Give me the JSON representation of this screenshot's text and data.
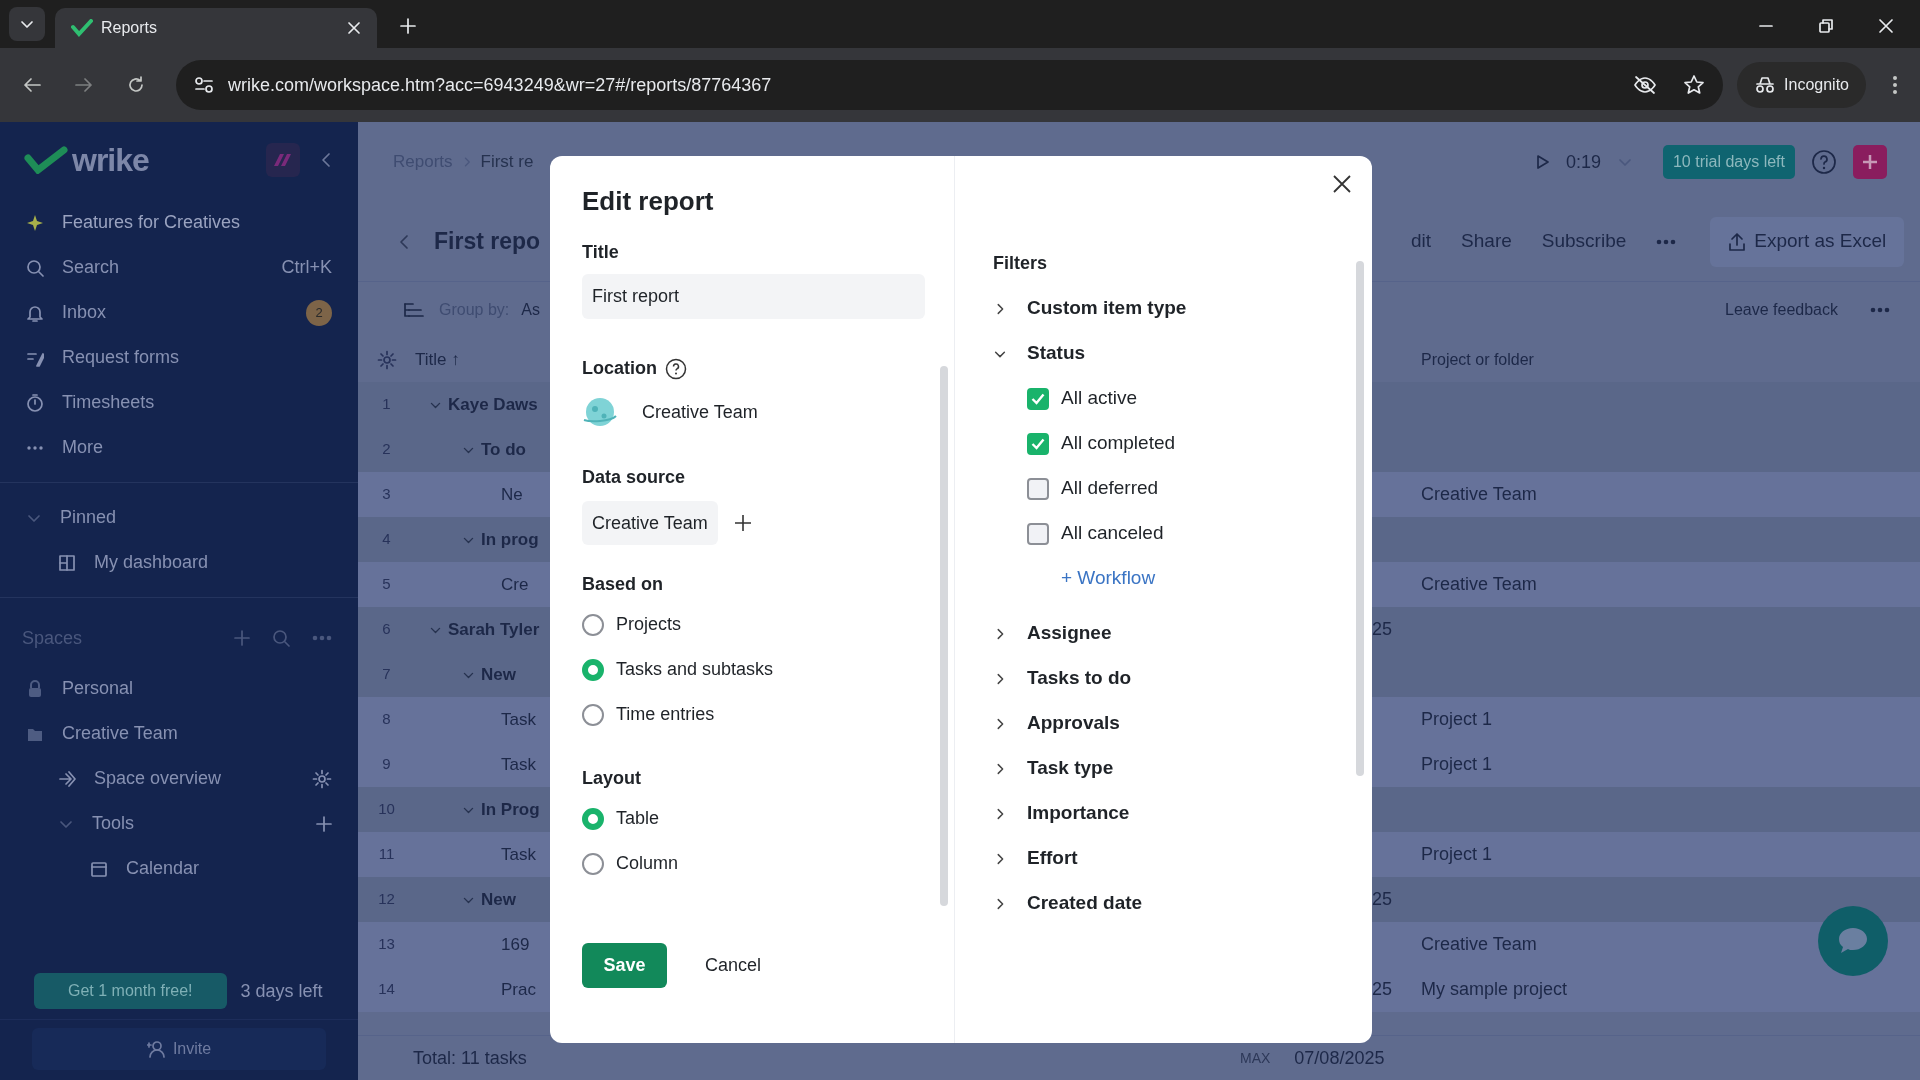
{
  "browser": {
    "tab_title": "Reports",
    "url": "wrike.com/workspace.htm?acc=6943249&wr=27#/reports/87764367",
    "profile": "Incognito"
  },
  "sidebar": {
    "logo": "wrike",
    "items": [
      {
        "kind": "sparkle",
        "label": "Features for Creatives"
      },
      {
        "kind": "search",
        "label": "Search",
        "shortcut": "Ctrl+K"
      },
      {
        "kind": "bell",
        "label": "Inbox",
        "badge": "2"
      },
      {
        "kind": "form",
        "label": "Request forms"
      },
      {
        "kind": "timer",
        "label": "Timesheets"
      },
      {
        "kind": "dots",
        "label": "More"
      }
    ],
    "pinned": {
      "label": "Pinned",
      "expanded": true,
      "items": [
        {
          "label": "My dashboard"
        }
      ]
    },
    "spaces": {
      "label": "Spaces",
      "items": [
        {
          "kind": "lock",
          "label": "Personal"
        },
        {
          "kind": "folder",
          "label": "Creative Team",
          "children": [
            {
              "kind": "overview",
              "label": "Space overview"
            },
            {
              "kind": "tools",
              "label": "Tools",
              "expanded": true,
              "children": [
                {
                  "kind": "calendar",
                  "label": "Calendar"
                }
              ]
            }
          ]
        }
      ]
    },
    "promo": {
      "button": "Get 1 month free!",
      "note": "3 days left"
    },
    "invite": "Invite"
  },
  "header": {
    "breadcrumbs": [
      "Reports",
      "First re"
    ],
    "timer": "0:19",
    "trial": "10 trial days left",
    "title": "First repo",
    "actions": [
      "dit",
      "Share",
      "Subscribe"
    ],
    "export": "Export as Excel",
    "group_by_label": "Group by:",
    "group_by_value": "As",
    "feedback": "Leave feedback"
  },
  "table": {
    "columns": [
      "Title ↑",
      "Project or folder"
    ],
    "rows": [
      {
        "number": "1",
        "title": "Kaye Daws",
        "expanded": true,
        "children": [
          {
            "number": "2",
            "title": "To do",
            "expanded": true,
            "children": [
              {
                "number": "3",
                "title": "Ne",
                "project": "Creative Team"
              }
            ]
          },
          {
            "number": "4",
            "title": "In prog",
            "expanded": true,
            "children": [
              {
                "number": "5",
                "title": "Cre",
                "project": "Creative Team"
              }
            ]
          }
        ]
      },
      {
        "number": "6",
        "title": "Sarah Tyler",
        "date": "25",
        "expanded": true,
        "children": [
          {
            "number": "7",
            "title": "New",
            "expanded": true,
            "children": [
              {
                "number": "8",
                "title": "Task",
                "project": "Project 1"
              },
              {
                "number": "9",
                "title": "Task",
                "project": "Project 1"
              }
            ]
          },
          {
            "number": "10",
            "title": "In Prog",
            "expanded": true,
            "children": [
              {
                "number": "11",
                "title": "Task",
                "project": "Project 1"
              }
            ]
          },
          {
            "number": "12",
            "title": "New",
            "date": "25",
            "expanded": true,
            "children": [
              {
                "number": "13",
                "title": "169",
                "project": "Creative Team"
              },
              {
                "number": "14",
                "title": "Prac",
                "date": "25",
                "project": "My sample project"
              }
            ]
          }
        ]
      }
    ],
    "footer": {
      "total": "Total: 11 tasks",
      "max_label": "MAX",
      "max_value": "07/08/2025"
    }
  },
  "modal": {
    "title": "Edit report",
    "title_label": "Title",
    "title_value": "First report",
    "location_label": "Location",
    "location_value": "Creative Team",
    "data_source_label": "Data source",
    "data_source": "Creative Team",
    "based_on_label": "Based on",
    "based_on": [
      {
        "label": "Projects",
        "selected": false
      },
      {
        "label": "Tasks and subtasks",
        "selected": true
      },
      {
        "label": "Time entries",
        "selected": false
      }
    ],
    "layout_label": "Layout",
    "layout": [
      {
        "label": "Table",
        "selected": true
      },
      {
        "label": "Column",
        "selected": false
      }
    ],
    "save": "Save",
    "cancel": "Cancel",
    "filters_label": "Filters",
    "filters": [
      {
        "label": "Custom item type",
        "expanded": false
      },
      {
        "label": "Status",
        "expanded": true,
        "options": [
          {
            "label": "All active",
            "checked": true
          },
          {
            "label": "All completed",
            "checked": true
          },
          {
            "label": "All deferred",
            "checked": false
          },
          {
            "label": "All canceled",
            "checked": false
          }
        ],
        "link": "+ Workflow"
      },
      {
        "label": "Assignee",
        "expanded": false
      },
      {
        "label": "Tasks to do",
        "expanded": false
      },
      {
        "label": "Approvals",
        "expanded": false
      },
      {
        "label": "Task type",
        "expanded": false
      },
      {
        "label": "Importance",
        "expanded": false
      },
      {
        "label": "Effort",
        "expanded": false
      },
      {
        "label": "Created date",
        "expanded": false
      }
    ]
  }
}
